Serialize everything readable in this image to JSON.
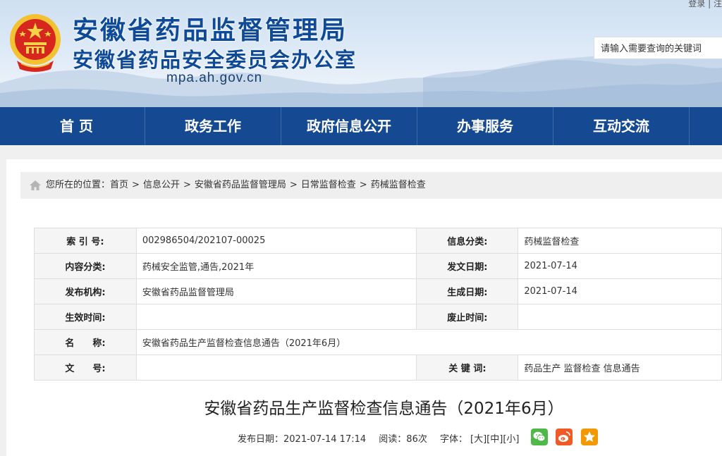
{
  "header": {
    "title_line1": "安徽省药品监督管理局",
    "title_line2": "安徽省药品安全委员会办公室",
    "domain": "mpa.ah.gov.cn",
    "top_links": [
      "登录",
      "|",
      "注"
    ],
    "search": {
      "placeholder": "请输入需要查询的关键词"
    }
  },
  "nav": {
    "items": [
      "首 页",
      "政务工作",
      "政府信息公开",
      "办事服务",
      "互动交流"
    ]
  },
  "breadcrumb": {
    "prefix": "您所在的位置：",
    "items": [
      "首页",
      "信息公开",
      "安徽省药品监督管理局",
      "日常监督检查",
      "药械监督检查"
    ],
    "separator": ">"
  },
  "info": {
    "index_label": "索 引 号:",
    "index_value": "002986504/202107-00025",
    "category_label": "信息分类:",
    "category_value": "药械监督检查",
    "content_cat_label": "内容分类:",
    "content_cat_value": "药械安全监管,通告,2021年",
    "issue_date_label": "发文日期:",
    "issue_date_value": "2021-07-14",
    "publisher_label": "发布机构:",
    "publisher_value": "安徽省药品监督管理局",
    "gen_date_label": "生成日期:",
    "gen_date_value": "2021-07-14",
    "effective_label": "生效时间:",
    "effective_value": "",
    "expire_label": "废止时间:",
    "expire_value": "",
    "name_label": "名　　称:",
    "name_value": "安徽省药品生产监督检查信息通告（2021年6月）",
    "docno_label": "文　　号:",
    "docno_value": "",
    "keywords_label": "关 键 词:",
    "keywords_value": "药品生产 监督检查 信息通告"
  },
  "article": {
    "title": "安徽省药品生产监督检查信息通告（2021年6月）",
    "publish_label": "发布日期：2021-07-14 17:14",
    "reads": "阅读：86次",
    "font_label": "字体：",
    "font_large": "[大]",
    "font_medium": "[中]",
    "font_small": "[小]"
  },
  "colors": {
    "nav_bg": "#154a92",
    "title_blue": "#0e4a97",
    "wechat": "#4fb848",
    "weibo": "#f05a24",
    "favorite": "#f39800"
  },
  "icons": {
    "emblem": "national-emblem-icon",
    "home": "home-icon",
    "share": [
      "wechat-icon",
      "weibo-icon",
      "favorite-star-icon"
    ]
  }
}
